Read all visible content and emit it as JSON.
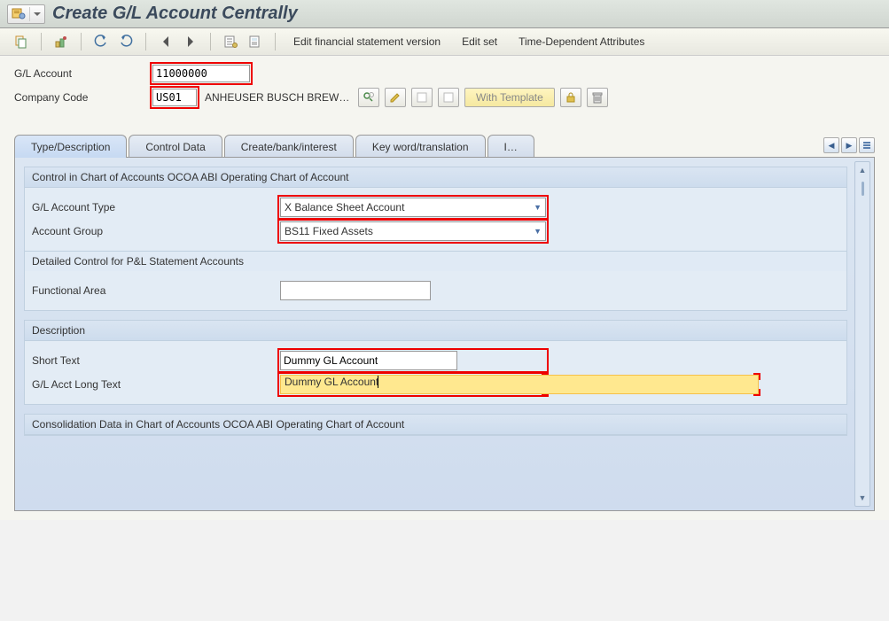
{
  "header": {
    "title": "Create G/L Account Centrally"
  },
  "toolbar": {
    "items": [
      {
        "name": "edit-financial-statement",
        "label": "Edit financial statement version"
      },
      {
        "name": "edit-set",
        "label": "Edit set"
      },
      {
        "name": "time-dep-attr",
        "label": "Time-Dependent Attributes"
      }
    ]
  },
  "fields": {
    "gl_account_label": "G/L Account",
    "gl_account_value": "11000000",
    "company_code_label": "Company Code",
    "company_code_value": "US01",
    "company_code_desc": "ANHEUSER BUSCH BREWI…",
    "with_template": "With Template"
  },
  "tabs": [
    {
      "name": "tab-type-desc",
      "label": "Type/Description",
      "active": true
    },
    {
      "name": "tab-control",
      "label": "Control Data",
      "active": false
    },
    {
      "name": "tab-bank",
      "label": "Create/bank/interest",
      "active": false
    },
    {
      "name": "tab-keyword",
      "label": "Key word/translation",
      "active": false
    },
    {
      "name": "tab-more",
      "label": "I…",
      "active": false
    }
  ],
  "panel": {
    "group1": {
      "header": "Control in Chart of Accounts OCOA ABI Operating Chart of Account",
      "gl_account_type_label": "G/L Account Type",
      "gl_account_type_value": "X Balance Sheet Account",
      "account_group_label": "Account Group",
      "account_group_value": "BS11 Fixed Assets",
      "sub_header": "Detailed Control for P&L Statement Accounts",
      "functional_area_label": "Functional Area",
      "functional_area_value": ""
    },
    "group2": {
      "header": "Description",
      "short_text_label": "Short Text",
      "short_text_value": "Dummy GL Account",
      "long_text_label": "G/L Acct Long Text",
      "long_text_value": "Dummy GL Account"
    },
    "group3": {
      "header": "Consolidation Data in Chart of Accounts OCOA ABI Operating Chart of Account"
    }
  }
}
